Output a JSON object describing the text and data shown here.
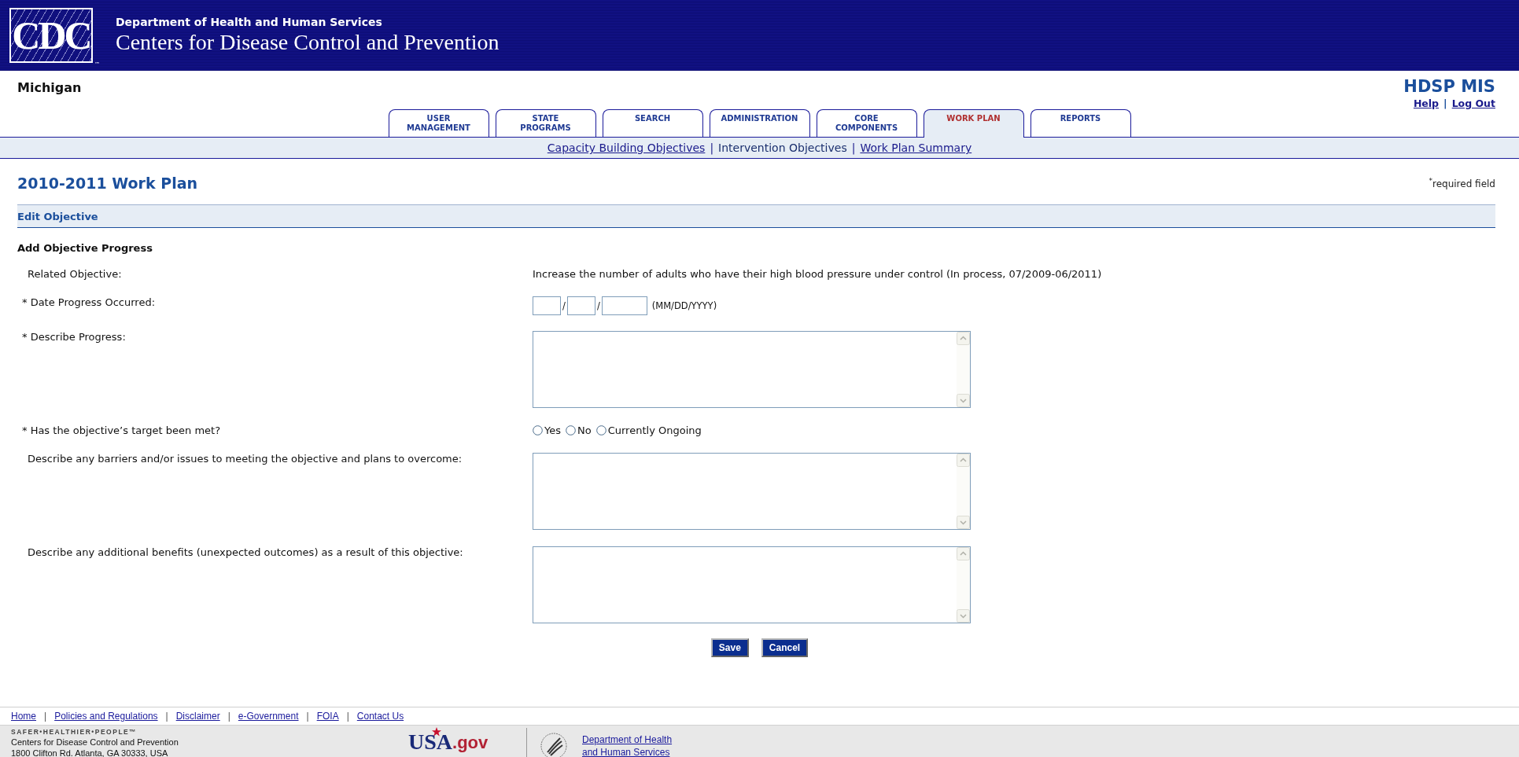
{
  "header": {
    "logo": "CDC",
    "trademark": "™",
    "department": "Department of Health and Human Services",
    "agency": "Centers for Disease Control and Prevention"
  },
  "state": "Michigan",
  "app_name": "HDSP MIS",
  "link_separator": "|",
  "date_separator": "/",
  "user_links": [
    {
      "label": "Help"
    },
    {
      "label": "Log Out"
    }
  ],
  "tabs": [
    {
      "label": "USER MANAGEMENT",
      "selected": false
    },
    {
      "label": "STATE PROGRAMS",
      "selected": false
    },
    {
      "label": "SEARCH",
      "selected": false
    },
    {
      "label": "ADMINISTRATION",
      "selected": false
    },
    {
      "label": "CORE COMPONENTS",
      "selected": false
    },
    {
      "label": "WORK PLAN",
      "selected": true
    },
    {
      "label": "REPORTS",
      "selected": false
    }
  ],
  "subnav": [
    {
      "label": "Capacity Building Objectives",
      "selected": false
    },
    {
      "label": "Intervention Objectives",
      "selected": true
    },
    {
      "label": "Work Plan Summary",
      "selected": false
    }
  ],
  "page_title": "2010-2011 Work Plan",
  "required_note": {
    "mark": "*",
    "text": "required field"
  },
  "section_title": "Edit Objective",
  "form_title": "Add Objective Progress",
  "fields": [
    {
      "kind": "text",
      "label": "Related Objective:",
      "value": "Increase the number of adults who have their high blood pressure under control (In process, 07/2009-06/2011)"
    },
    {
      "kind": "date",
      "label": "* Date Progress Occurred:",
      "hint": "(MM/DD/YYYY)"
    },
    {
      "kind": "textarea",
      "label": "* Describe Progress:"
    },
    {
      "kind": "radio",
      "label": "* Has the objective’s target been met?",
      "options": [
        {
          "label": "Yes",
          "selected": false
        },
        {
          "label": "No",
          "selected": false
        },
        {
          "label": "Currently Ongoing",
          "selected": false
        }
      ]
    },
    {
      "kind": "textarea",
      "label": "Describe any barriers and/or issues to meeting the objective and plans to overcome:"
    },
    {
      "kind": "textarea",
      "label": "Describe any additional benefits (unexpected outcomes) as a result of this objective:"
    }
  ],
  "buttons": [
    "Save",
    "Cancel"
  ],
  "footer": {
    "links": [
      "Home",
      "Policies and Regulations",
      "Disclaimer",
      "e-Government",
      "FOIA",
      "Contact Us"
    ],
    "tagline": "SAFER•HEALTHIER•PEOPLE™",
    "address": [
      "Centers for Disease Control and Prevention",
      "1800 Clifton Rd. Atlanta, GA 30333, USA"
    ],
    "usa_logo": {
      "main": "USA",
      "suffix": ".gov"
    },
    "hhs_link": [
      "Department of Health",
      "and Human Services"
    ]
  }
}
